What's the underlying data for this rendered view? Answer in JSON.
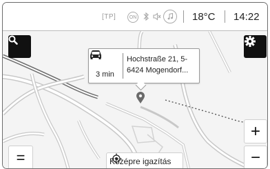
{
  "status_bar": {
    "tp_label": "[TP]",
    "on_label": "ON",
    "bluetooth_icon": "bluetooth-icon",
    "mute_icon": "volume-mute-icon",
    "music_icon": "music-note-icon",
    "temperature": "18°C",
    "time": "14:22"
  },
  "map": {
    "search_icon": "search-icon",
    "settings_icon": "gear-icon",
    "zoom_in_label": "+",
    "zoom_out_label": "−",
    "menu_label": "=",
    "center_button_label": "Középre igazítás",
    "center_icon": "crosshair-icon",
    "pin_icon": "map-pin-icon"
  },
  "destination_popup": {
    "vehicle_icon": "car-icon",
    "eta": "3 min",
    "address_line1": "Hochstraße 21, 5-",
    "address_line2": "6424 Mogendorf..."
  },
  "colors": {
    "road": "#c8c8c8",
    "road_dark": "#6f6f6f",
    "button_dark": "#111111"
  }
}
